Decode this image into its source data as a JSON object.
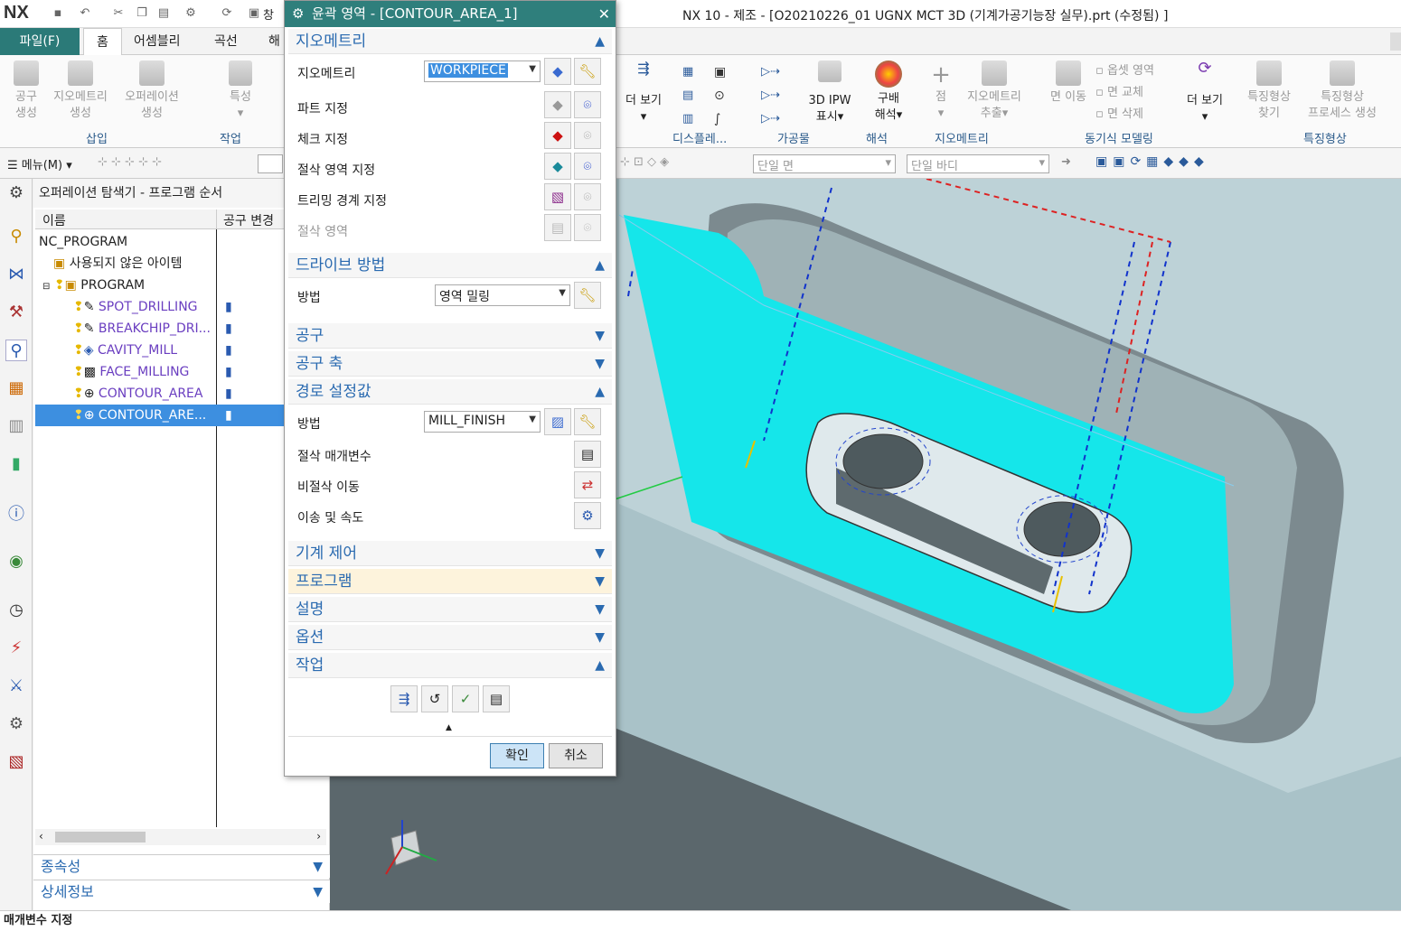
{
  "titlebar": {
    "logo": "NX",
    "window_menu": "창",
    "title": "NX 10 - 제조 - [O20210226_01 UGNX MCT 3D (기계가공기능장 실무).prt (수정됨) ]"
  },
  "tabs": [
    "파일(F)",
    "홈",
    "어셈블리",
    "곡선",
    "해"
  ],
  "ribbon": {
    "left_buttons": [
      {
        "line1": "공구",
        "line2": "생성"
      },
      {
        "line1": "지오메트리",
        "line2": "생성"
      },
      {
        "line1": "오퍼레이션",
        "line2": "생성"
      },
      {
        "line1": "특성",
        "line2": ""
      }
    ],
    "right_buttons": [
      {
        "line1": "더 보기",
        "line2": ""
      },
      {
        "line1": "3D IPW",
        "line2": "표시"
      },
      {
        "line1": "구배",
        "line2": "해석"
      },
      {
        "line1": "점",
        "line2": ""
      },
      {
        "line1": "지오메트리",
        "line2": "추출"
      },
      {
        "line1": "면 이동",
        "line2": ""
      },
      {
        "line1": "더 보기",
        "line2": ""
      },
      {
        "line1": "특징형상",
        "line2": "찾기"
      },
      {
        "line1": "특징형상",
        "line2": "프로세스 생성"
      }
    ],
    "sync_items": [
      "옵셋 영역",
      "면 교체",
      "면 삭제"
    ],
    "groups": [
      "삽입",
      "작업",
      "디스플레...",
      "가공물",
      "해석",
      "지오메트리",
      "동기식 모델링",
      "특징형상"
    ]
  },
  "subtoolbar": {
    "menu": "메뉴(M)",
    "face_filter": "단일 면",
    "body_filter": "단일 바디"
  },
  "navigator": {
    "title": "오퍼레이션 탐색기 - 프로그램 순서",
    "col_name": "이름",
    "col_tool": "공구 변경",
    "root": "NC_PROGRAM",
    "unused": "사용되지 않은 아이템",
    "program": "PROGRAM",
    "operations": [
      "SPOT_DRILLING",
      "BREAKCHIP_DRI...",
      "CAVITY_MILL",
      "FACE_MILLING",
      "CONTOUR_AREA",
      "CONTOUR_ARE..."
    ],
    "panel_dependencies": "종속성",
    "panel_details": "상세정보"
  },
  "dialog": {
    "title": "윤곽 영역 - [CONTOUR_AREA_1]",
    "sec_geometry": "지오메트리",
    "geometry_label": "지오메트리",
    "geometry_value": "WORKPIECE",
    "part": "파트 지정",
    "check": "체크 지정",
    "cut_area": "절삭 영역 지정",
    "trim": "트리밍 경계 지정",
    "cut_region": "절삭 영역",
    "sec_drive": "드라이브 방법",
    "drive_label": "방법",
    "drive_value": "영역 밀링",
    "sec_tool": "공구",
    "sec_axis": "공구 축",
    "sec_path": "경로 설정값",
    "path_label": "방법",
    "path_value": "MILL_FINISH",
    "cut_params": "절삭 매개변수",
    "non_cut": "비절삭 이동",
    "feeds": "이송 및 속도",
    "sec_machine": "기계 제어",
    "sec_program": "프로그램",
    "sec_desc": "설명",
    "sec_options": "옵션",
    "sec_actions": "작업",
    "ok": "확인",
    "cancel": "취소"
  },
  "status": "매개변수 지정"
}
